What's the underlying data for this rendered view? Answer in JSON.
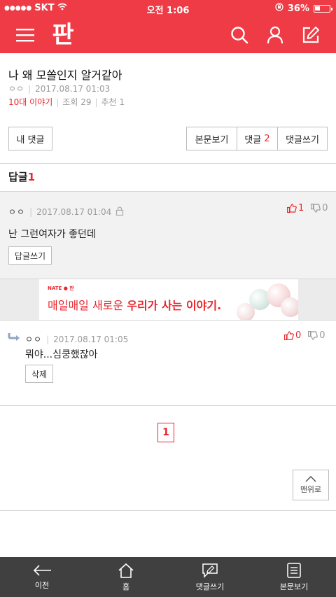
{
  "status_bar": {
    "carrier": "SKT",
    "time": "오전 1:06",
    "battery": "36%"
  },
  "header": {
    "logo": "판"
  },
  "article": {
    "title": "나 왜 모쏠인지 알거같아",
    "author": "ㅇㅇ",
    "date": "2017.08.17 01:03",
    "category": "10대 이야기",
    "views": "조회 29",
    "recommends": "추천 1"
  },
  "actions": {
    "my_comments": "내 댓글",
    "view_article": "본문보기",
    "comments_label": "댓글",
    "comments_count": "2",
    "write_comment": "댓글쓰기"
  },
  "replies_section": {
    "label": "답글",
    "count": "1"
  },
  "reply1": {
    "author": "ㅇㅇ",
    "date": "2017.08.17 01:04",
    "text": "난 그런여자가 좋던데",
    "reply_button": "답글쓰기",
    "up": "1",
    "down": "0"
  },
  "banner": {
    "brand": "NATE ● 판",
    "text_plain": "매일매일 새로운 ",
    "text_bold": "우리가 사는 이야기."
  },
  "reply2": {
    "author": "ㅇㅇ",
    "date": "2017.08.17 01:05",
    "text": "뭐야...심쿵했잖아",
    "delete_button": "삭제",
    "up": "0",
    "down": "0"
  },
  "pagination": {
    "current": "1"
  },
  "to_top": "맨위로",
  "tabbar": {
    "back": "이전",
    "home": "홈",
    "write": "댓글쓰기",
    "article": "본문보기"
  },
  "colors": {
    "brand_red": "#ef3b45",
    "accent_red": "#e8262e",
    "tabbar_bg": "#404040"
  }
}
